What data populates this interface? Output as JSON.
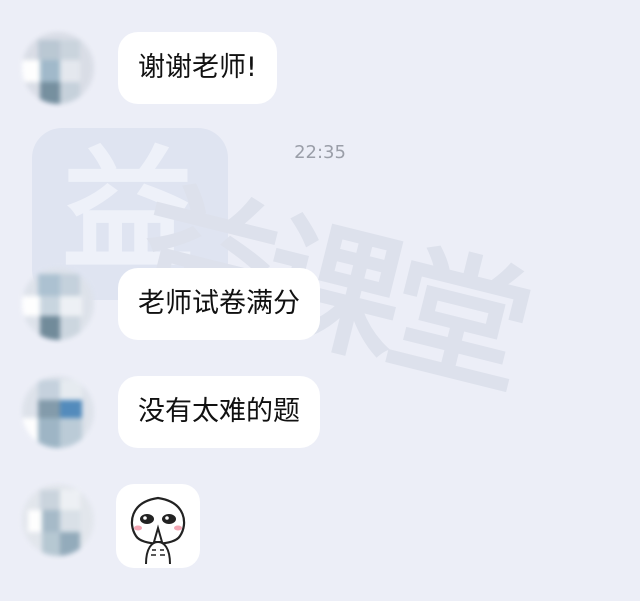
{
  "watermark": {
    "logo_char": "益",
    "text": "益课堂"
  },
  "timestamp": "22:35",
  "messages": [
    {
      "text": "谢谢老师!"
    },
    {
      "text": "老师试卷满分"
    },
    {
      "text": "没有太难的题"
    },
    {
      "sticker": "praying-face-sticker"
    }
  ],
  "colors": {
    "background": "#eceef7",
    "bubble": "#ffffff",
    "text": "#111111",
    "timestamp": "#9a9ea8"
  }
}
